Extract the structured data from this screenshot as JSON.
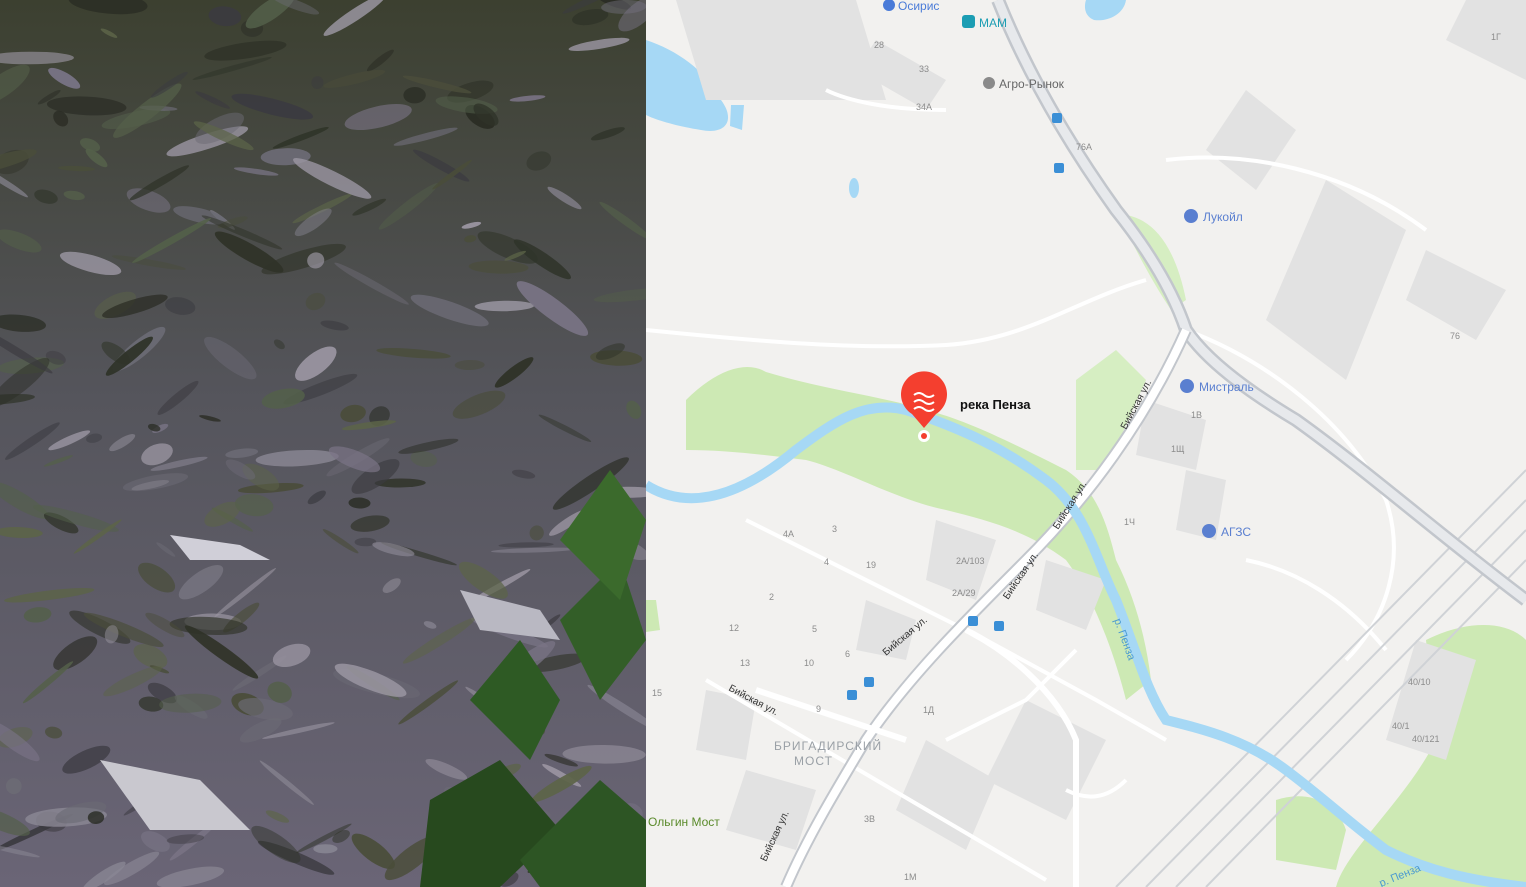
{
  "map": {
    "pin": {
      "label": "река Пенза",
      "icon": "water-waves-icon",
      "color": "#f43f2f"
    },
    "river_label": "р. Пенза",
    "river_label_lower": "р. Пенза",
    "district_label_line1": "БРИГАДИРСКИЙ",
    "district_label_line2": "МОСТ",
    "locality_label": "Ольгин Мост",
    "street_labels": [
      "Бийская ул.",
      "Бийская ул.",
      "Бийская ул.",
      "Бийская ул.",
      "Бийская ул.",
      "Бийская ул."
    ],
    "pois": [
      {
        "name": "Осирис",
        "icon": "pin-icon",
        "color": "#4a7bd8"
      },
      {
        "name": "МАМ",
        "icon": "shop-icon",
        "color": "#1c9db3"
      },
      {
        "name": "Агро-Рынок",
        "icon": "pin-icon",
        "color": "#8a8a8a"
      },
      {
        "name": "Лукойл",
        "icon": "fuel-icon",
        "color": "#5a7fd0"
      },
      {
        "name": "Мистраль",
        "icon": "fuel-icon",
        "color": "#5a7fd0"
      },
      {
        "name": "АГЗС",
        "icon": "gas-icon",
        "color": "#5a7fd0"
      }
    ],
    "house_numbers": [
      "28",
      "33",
      "34А",
      "76А",
      "1Г",
      "76",
      "1В",
      "1Щ",
      "1Ч",
      "4А",
      "3",
      "4",
      "19",
      "2А/103",
      "2А/29",
      "2",
      "12",
      "5",
      "6",
      "13",
      "10",
      "15",
      "9",
      "1Д",
      "3В",
      "1М",
      "40/10",
      "40/1",
      "40/121"
    ],
    "colors": {
      "water": "#a6d8f5",
      "park": "#cde9b4",
      "road": "#ffffff",
      "highway": "#c2c6cc",
      "building": "#e2e2e2"
    }
  }
}
